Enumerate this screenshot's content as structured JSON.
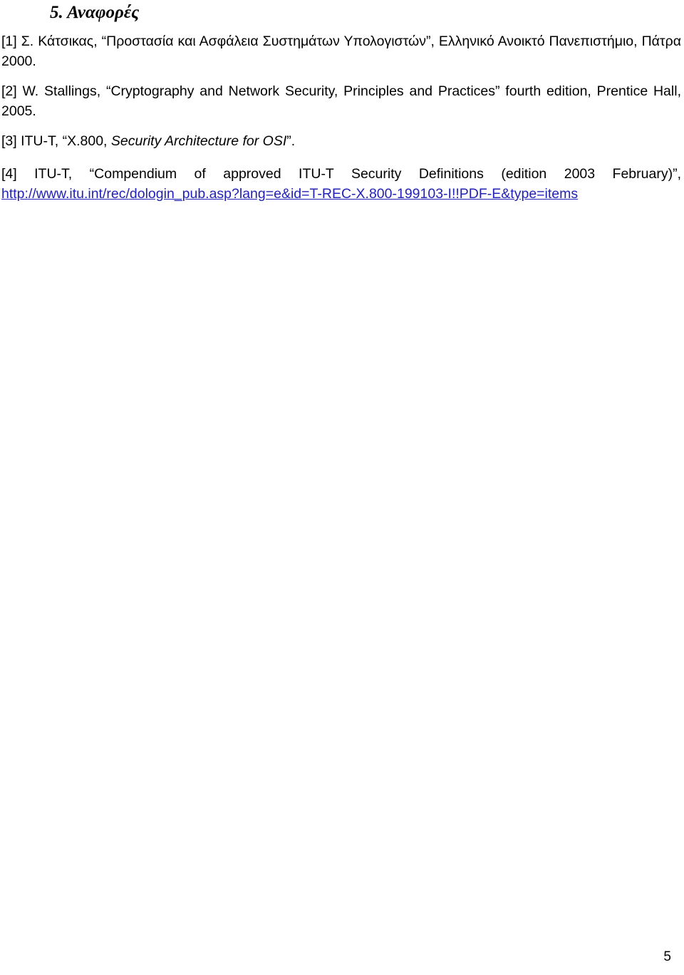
{
  "document": {
    "page_number": "5",
    "link_color": "#2222B4",
    "text_color": "#000000",
    "background_color": "#FFFFFF"
  },
  "section": {
    "heading": "5. Αναφορές"
  },
  "references": [
    {
      "marker": "[1]",
      "text": "[1] Σ. Κάτσικας, “Προστασία και Ασφάλεια Συστημάτων Υπολογιστών”, Ελληνικό Ανοικτό Πανεπιστήμιο, Πάτρα 2000."
    },
    {
      "marker": "[2]",
      "text": "[2] W. Stallings, “Cryptography and Network Security, Principles and Practices” fourth edition, Prentice Hall, 2005."
    },
    {
      "marker": "[3]",
      "prefix": "[3] ITU-T, “X.800, ",
      "italic": "Security Architecture for OSI",
      "suffix": "”."
    },
    {
      "marker": "[4]",
      "text": "[4] ITU-T, “Compendium of approved ITU-T Security Definitions (edition 2003 February)”,",
      "url": "http://www.itu.int/rec/dologin_pub.asp?lang=e&id=T-REC-X.800-199103-I!!PDF-E&type=items"
    }
  ]
}
